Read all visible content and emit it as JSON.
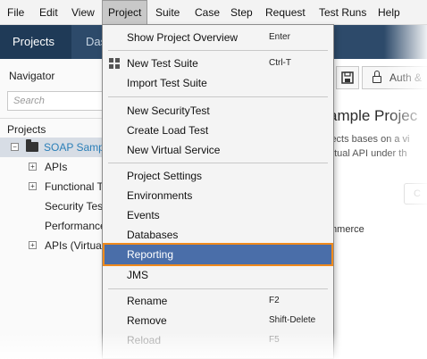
{
  "menubar": {
    "items": [
      "File",
      "Edit",
      "View",
      "Project",
      "Suite",
      "Case",
      "Step",
      "Request",
      "Test Runs",
      "Help"
    ]
  },
  "tabs": [
    "Projects",
    "Das"
  ],
  "navigator": {
    "title": "Navigator",
    "search_placeholder": "Search",
    "projects_label": "Projects",
    "tree": [
      "SOAP Samp",
      "APIs",
      "Functional T",
      "Security Tes",
      "Performance",
      "APIs (Virtua"
    ]
  },
  "toolbar": {
    "auth_label": "Auth &"
  },
  "content": {
    "title": "ample Projec",
    "line1": "jects bases on a vi",
    "line2": "irtual API under th",
    "pill": "C",
    "item": "mmerce"
  },
  "project_menu": {
    "items": [
      {
        "label": "Show Project Overview",
        "shortcut": "Enter"
      },
      {
        "label": "New Test Suite",
        "shortcut": "Ctrl-T",
        "icon": "grid-icon"
      },
      {
        "label": "Import Test Suite",
        "shortcut": ""
      },
      {
        "label": "New SecurityTest",
        "shortcut": ""
      },
      {
        "label": "Create Load Test",
        "shortcut": ""
      },
      {
        "label": "New Virtual Service",
        "shortcut": ""
      },
      {
        "label": "Project Settings",
        "shortcut": ""
      },
      {
        "label": "Environments",
        "shortcut": ""
      },
      {
        "label": "Events",
        "shortcut": ""
      },
      {
        "label": "Databases",
        "shortcut": ""
      },
      {
        "label": "Reporting",
        "shortcut": "",
        "highlighted": true
      },
      {
        "label": "JMS",
        "shortcut": ""
      },
      {
        "label": "Rename",
        "shortcut": "F2"
      },
      {
        "label": "Remove",
        "shortcut": "Shift-Delete"
      },
      {
        "label": "Reload",
        "shortcut": "F5",
        "disabled": true
      }
    ]
  },
  "colors": {
    "tabbar": "#2d4a6a",
    "highlight": "#4a6ea9",
    "highlight_outline": "#f08a1c",
    "link": "#2b7fb8"
  }
}
